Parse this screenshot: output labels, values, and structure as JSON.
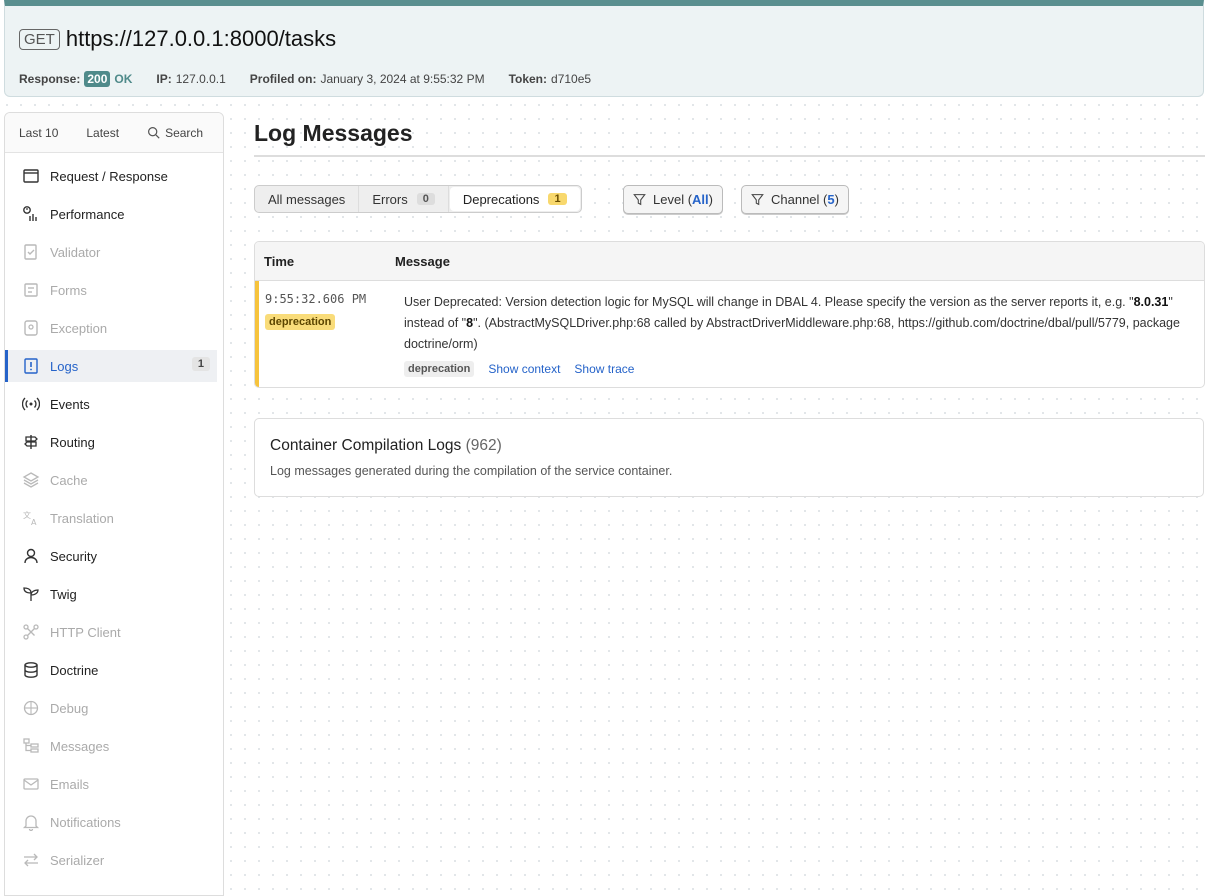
{
  "summary": {
    "method": "GET",
    "url": "https://127.0.0.1:8000/tasks",
    "response_label": "Response:",
    "status_code": "200",
    "status_text": "OK",
    "ip_label": "IP:",
    "ip_value": "127.0.0.1",
    "profiled_label": "Profiled on:",
    "profiled_value": "January 3, 2024 at 9:55:32 PM",
    "token_label": "Token:",
    "token_value": "d710e5"
  },
  "sidebar": {
    "tabs": {
      "last10": "Last 10",
      "latest": "Latest",
      "search": "Search"
    },
    "items": [
      {
        "label": "Request / Response",
        "icon": "request-icon",
        "disabled": false
      },
      {
        "label": "Performance",
        "icon": "performance-icon",
        "disabled": false
      },
      {
        "label": "Validator",
        "icon": "validator-icon",
        "disabled": true
      },
      {
        "label": "Forms",
        "icon": "forms-icon",
        "disabled": true
      },
      {
        "label": "Exception",
        "icon": "exception-icon",
        "disabled": true
      },
      {
        "label": "Logs",
        "icon": "logs-icon",
        "disabled": false,
        "active": true,
        "count": "1"
      },
      {
        "label": "Events",
        "icon": "events-icon",
        "disabled": false
      },
      {
        "label": "Routing",
        "icon": "routing-icon",
        "disabled": false
      },
      {
        "label": "Cache",
        "icon": "cache-icon",
        "disabled": true
      },
      {
        "label": "Translation",
        "icon": "translation-icon",
        "disabled": true
      },
      {
        "label": "Security",
        "icon": "security-icon",
        "disabled": false
      },
      {
        "label": "Twig",
        "icon": "twig-icon",
        "disabled": false
      },
      {
        "label": "HTTP Client",
        "icon": "http-client-icon",
        "disabled": true
      },
      {
        "label": "Doctrine",
        "icon": "doctrine-icon",
        "disabled": false
      },
      {
        "label": "Debug",
        "icon": "debug-icon",
        "disabled": true
      },
      {
        "label": "Messages",
        "icon": "messages-icon",
        "disabled": true
      },
      {
        "label": "Emails",
        "icon": "emails-icon",
        "disabled": true
      },
      {
        "label": "Notifications",
        "icon": "notifications-icon",
        "disabled": true
      },
      {
        "label": "Serializer",
        "icon": "serializer-icon",
        "disabled": true
      }
    ]
  },
  "main": {
    "title": "Log Messages",
    "tabs": [
      {
        "label": "All messages"
      },
      {
        "label": "Errors",
        "count": "0"
      },
      {
        "label": "Deprecations",
        "count": "1",
        "active": true
      }
    ],
    "filters": {
      "level_label": "Level",
      "level_value": "All",
      "channel_label": "Channel",
      "channel_value": "5"
    },
    "table": {
      "headers": {
        "time": "Time",
        "message": "Message"
      },
      "rows": [
        {
          "time": "9:55:32.606 PM",
          "level": "deprecation",
          "message_part1": "User Deprecated: Version detection logic for MySQL will change in DBAL 4. Please specify the version as the server reports it, e.g. \"",
          "message_bold1": "8.0.31",
          "message_part2": "\" instead of \"",
          "message_bold2": "8",
          "message_part3": "\". (AbstractMySQLDriver.php:68 called by AbstractDriverMiddleware.php:68, https://github.com/doctrine/dbal/pull/5779, package doctrine/orm)",
          "channel": "deprecation",
          "show_context": "Show context",
          "show_trace": "Show trace"
        }
      ]
    },
    "container_logs": {
      "title": "Container Compilation Logs",
      "count": "(962)",
      "description": "Log messages generated during the compilation of the service container."
    }
  }
}
